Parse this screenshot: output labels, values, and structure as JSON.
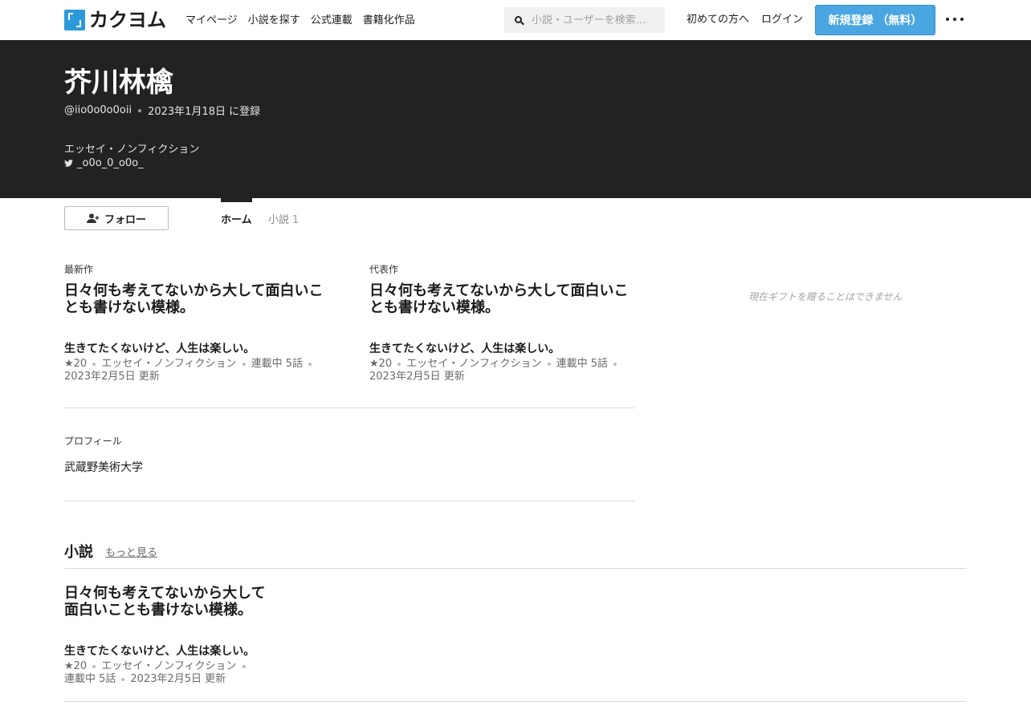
{
  "header": {
    "logo_text": "カクヨム",
    "nav": [
      "マイページ",
      "小説を探す",
      "公式連載",
      "書籍化作品"
    ],
    "search_placeholder": "小説・ユーザーを検索…",
    "beginners_link": "初めての方へ",
    "login_link": "ログイン",
    "signup_label": "新規登録 （無料）",
    "accent_color": "#4aa6e1"
  },
  "profile": {
    "name": "芥川林檎",
    "handle": "@iio0o0o0oii",
    "registered": "2023年1月18日 に登録",
    "genre": "エッセイ・ノンフィクション",
    "twitter": "_o0o_0_o0o_"
  },
  "actions": {
    "follow_label": "フォロー"
  },
  "tabs": {
    "home": "ホーム",
    "novels": "小説",
    "novels_count": "1"
  },
  "latest": {
    "label": "最新作",
    "title": "日々何も考えてないから大して面白いことも書けない模様。",
    "catchphrase": "生きてたくないけど、人生は楽しい。",
    "stars": "★20",
    "genre": "エッセイ・ノンフィクション",
    "status": "連載中 5話",
    "updated": "2023年2月5日 更新"
  },
  "featured": {
    "label": "代表作",
    "title": "日々何も考えてないから大して面白いことも書けない模様。",
    "catchphrase": "生きてたくないけど、人生は楽しい。",
    "stars": "★20",
    "genre": "エッセイ・ノンフィクション",
    "status": "連載中 5話",
    "updated": "2023年2月5日 更新"
  },
  "gift_note": "現在ギフトを贈ることはできません",
  "profile_section": {
    "label": "プロフィール",
    "text": "武蔵野美術大学"
  },
  "novels_section": {
    "heading": "小説",
    "see_more": "もっと見る",
    "items": [
      {
        "title_line1": "日々何も考えてないから大して",
        "title_line2": "面白いことも書けない模様。",
        "catchphrase": "生きてたくないけど、人生は楽しい。",
        "stars": "★20",
        "genre": "エッセイ・ノンフィクション",
        "status": "連載中 5話",
        "updated": "2023年2月5日 更新"
      }
    ]
  }
}
